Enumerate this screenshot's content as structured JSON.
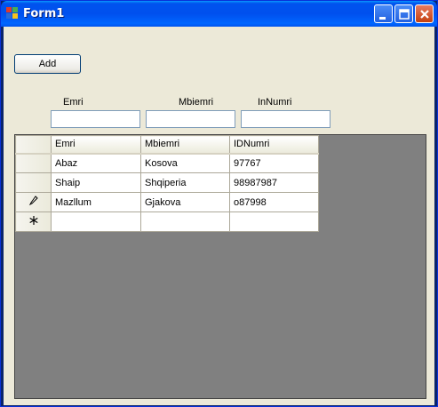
{
  "window": {
    "title": "Form1"
  },
  "form": {
    "add_label": "Add",
    "fields": [
      {
        "label": "Emri",
        "value": ""
      },
      {
        "label": "Mbiemri",
        "value": ""
      },
      {
        "label": "InNumri",
        "value": ""
      }
    ]
  },
  "grid": {
    "columns": [
      "Emri",
      "Mbiemri",
      "IDNumri"
    ],
    "rows": [
      {
        "header_icon": "",
        "cells": [
          "Abaz",
          "Kosova",
          "97767"
        ]
      },
      {
        "header_icon": "",
        "cells": [
          "Shaip",
          "Shqiperia",
          "98987987"
        ]
      },
      {
        "header_icon": "pencil-icon",
        "cells": [
          "Mazllum",
          "Gjakova",
          "o87998"
        ]
      },
      {
        "header_icon": "new-row-asterisk-icon",
        "cells": [
          "",
          "",
          ""
        ]
      }
    ]
  },
  "colors": {
    "titlebar": "#0053ee",
    "grid_background": "#808080",
    "client_background": "#ece9d8"
  }
}
